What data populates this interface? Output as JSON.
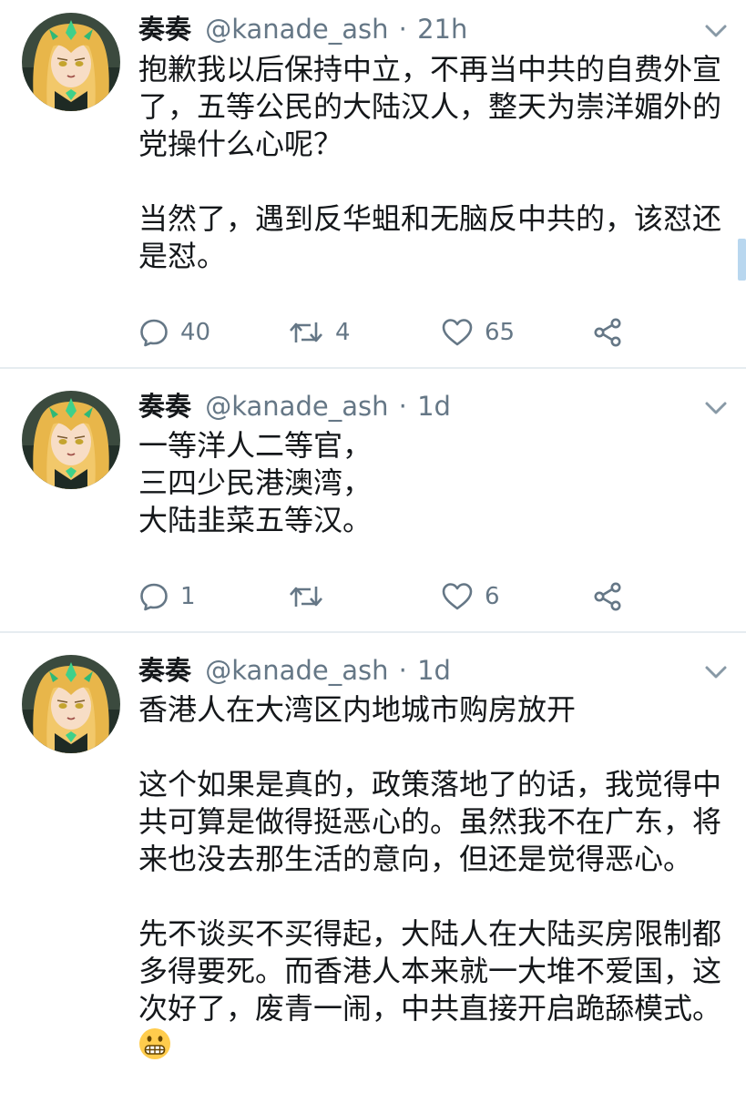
{
  "tweets": [
    {
      "name": "奏奏",
      "handle": "@kanade_ash",
      "time": "21h",
      "lines": [
        "抱歉我以后保持中立，不再当中共的自费外宣",
        "了，五等公民的大陆汉人，整天为崇洋媚外的",
        "党操什么心呢？",
        "",
        "当然了，遇到反华蛆和无脑反中共的，该怼还",
        "是怼。"
      ],
      "replies": "40",
      "retweets": "4",
      "likes": "65"
    },
    {
      "name": "奏奏",
      "handle": "@kanade_ash",
      "time": "1d",
      "lines": [
        "一等洋人二等官，",
        "三四少民港澳湾，",
        "大陆韭菜五等汉。"
      ],
      "replies": "1",
      "retweets": "",
      "likes": "6"
    },
    {
      "name": "奏奏",
      "handle": "@kanade_ash",
      "time": "1d",
      "lines": [
        "香港人在大湾区内地城市购房放开",
        "",
        "这个如果是真的，政策落地了的话，我觉得中",
        "共可算是做得挺恶心的。虽然我不在广东，将",
        "来也没去那生活的意向，但还是觉得恶心。",
        "",
        "先不谈买不买得起，大陆人在大陆买房限制都",
        "多得要死。而香港人本来就一大堆不爱国，这",
        "次好了，废青一闹，中共直接开启跪舔模式。"
      ],
      "emoji": "grimacing-face-emoji",
      "replies": "",
      "retweets": "",
      "likes": ""
    }
  ],
  "icons": {
    "reply": "reply-icon",
    "retweet": "retweet-icon",
    "like": "heart-icon",
    "share": "share-icon",
    "caret": "chevron-down-icon"
  },
  "colors": {
    "text": "#14171a",
    "muted": "#657786",
    "divider": "#e6ecf0",
    "scrollbar": "#b9d7ef"
  }
}
